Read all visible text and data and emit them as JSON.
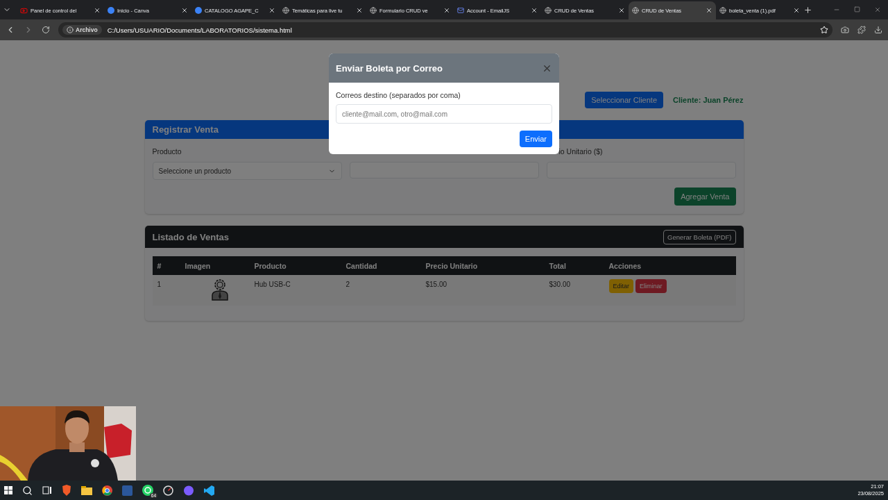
{
  "browser": {
    "tabs": [
      {
        "title": "Panel de control del",
        "selected": false
      },
      {
        "title": "Inicio - Canva",
        "selected": false
      },
      {
        "title": "CATALOGO AGAPE_C",
        "selected": false
      },
      {
        "title": "Temáticas para live tu",
        "selected": false
      },
      {
        "title": "Formulario CRUD ve",
        "selected": false
      },
      {
        "title": "Account - EmailJS",
        "selected": false
      },
      {
        "title": "CRUD de Ventas",
        "selected": false
      },
      {
        "title": "CRUD de Ventas",
        "selected": true
      },
      {
        "title": "boleta_venta (1).pdf",
        "selected": false
      }
    ],
    "address": {
      "chip": "Archivo",
      "url": "C:/Users/USUARIO/Documents/LABORATORIOS/sistema.html"
    }
  },
  "page": {
    "client_button": "Seleccionar Cliente",
    "client_label": "Cliente: Juan Pérez",
    "register": {
      "title": "Registrar Venta",
      "fields": [
        {
          "label": "Producto",
          "kind": "select",
          "value": "Seleccione un producto"
        },
        {
          "kind": "input"
        },
        {
          "label": "io Unitario ($)",
          "kind": "input"
        }
      ],
      "add_button": "Agregar Venta"
    },
    "listing": {
      "title": "Listado de Ventas",
      "pdf_button": "Generar Boleta (PDF)",
      "columns": [
        "#",
        "Imagen",
        "Producto",
        "Cantidad",
        "Precio Unitario",
        "Total",
        "Acciones"
      ],
      "rows": [
        {
          "index": "1",
          "product": "Hub USB-C",
          "quantity": "2",
          "unit_price": "$15.00",
          "total": "$30.00",
          "edit": "Editar",
          "delete": "Eliminar"
        }
      ]
    }
  },
  "modal": {
    "title": "Enviar Boleta por Correo",
    "field_label": "Correos destino (separados por coma)",
    "placeholder": "cliente@mail.com, otro@mail.com",
    "send_button": "Enviar"
  },
  "taskbar": {
    "whatsapp_badge": "64",
    "time": "21:07",
    "date": "23/08/2025"
  }
}
